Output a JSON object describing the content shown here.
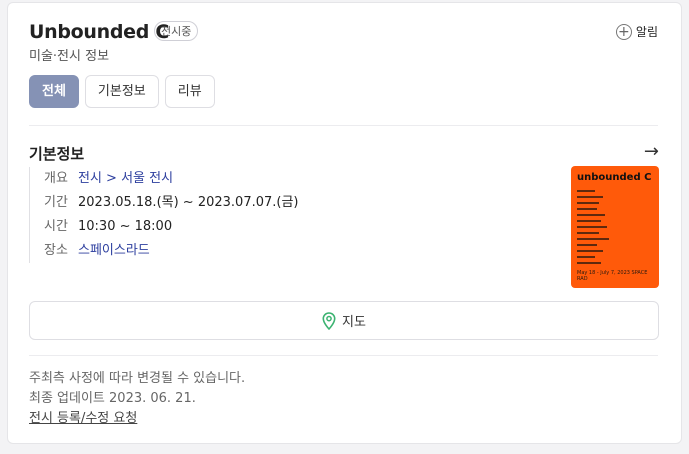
{
  "header": {
    "title": "Unbounded C",
    "status_badge": "전시중",
    "subtitle": "미술·전시 정보",
    "alarm_label": "알림"
  },
  "tabs": [
    {
      "label": "전체",
      "active": true
    },
    {
      "label": "기본정보",
      "active": false
    },
    {
      "label": "리뷰",
      "active": false
    }
  ],
  "basic_info": {
    "section_title": "기본정보",
    "rows": [
      {
        "key": "개요",
        "value": "전시 > 서울 전시"
      },
      {
        "key": "기간",
        "value": "2023.05.18.(목) ~ 2023.07.07.(금)"
      },
      {
        "key": "시간",
        "value": "10:30 ~ 18:00"
      },
      {
        "key": "장소",
        "value": "스페이스라드"
      }
    ],
    "poster": {
      "title": "unbounded C",
      "footer": "May 18 - July 7, 2023   SPACE RAD",
      "bg_color": "#ff5a0a"
    }
  },
  "map_button": {
    "label": "지도",
    "icon": "map-pin-icon"
  },
  "notice": {
    "line1": "주최측 사정에 따라 변경될 수 있습니다.",
    "line2": "최종 업데이트 2023. 06. 21.",
    "report_link": "전시 등록/수정 요청"
  },
  "colors": {
    "accent": "#8592b5",
    "link": "#2c3e9e",
    "map_pin": "#3cb371"
  }
}
